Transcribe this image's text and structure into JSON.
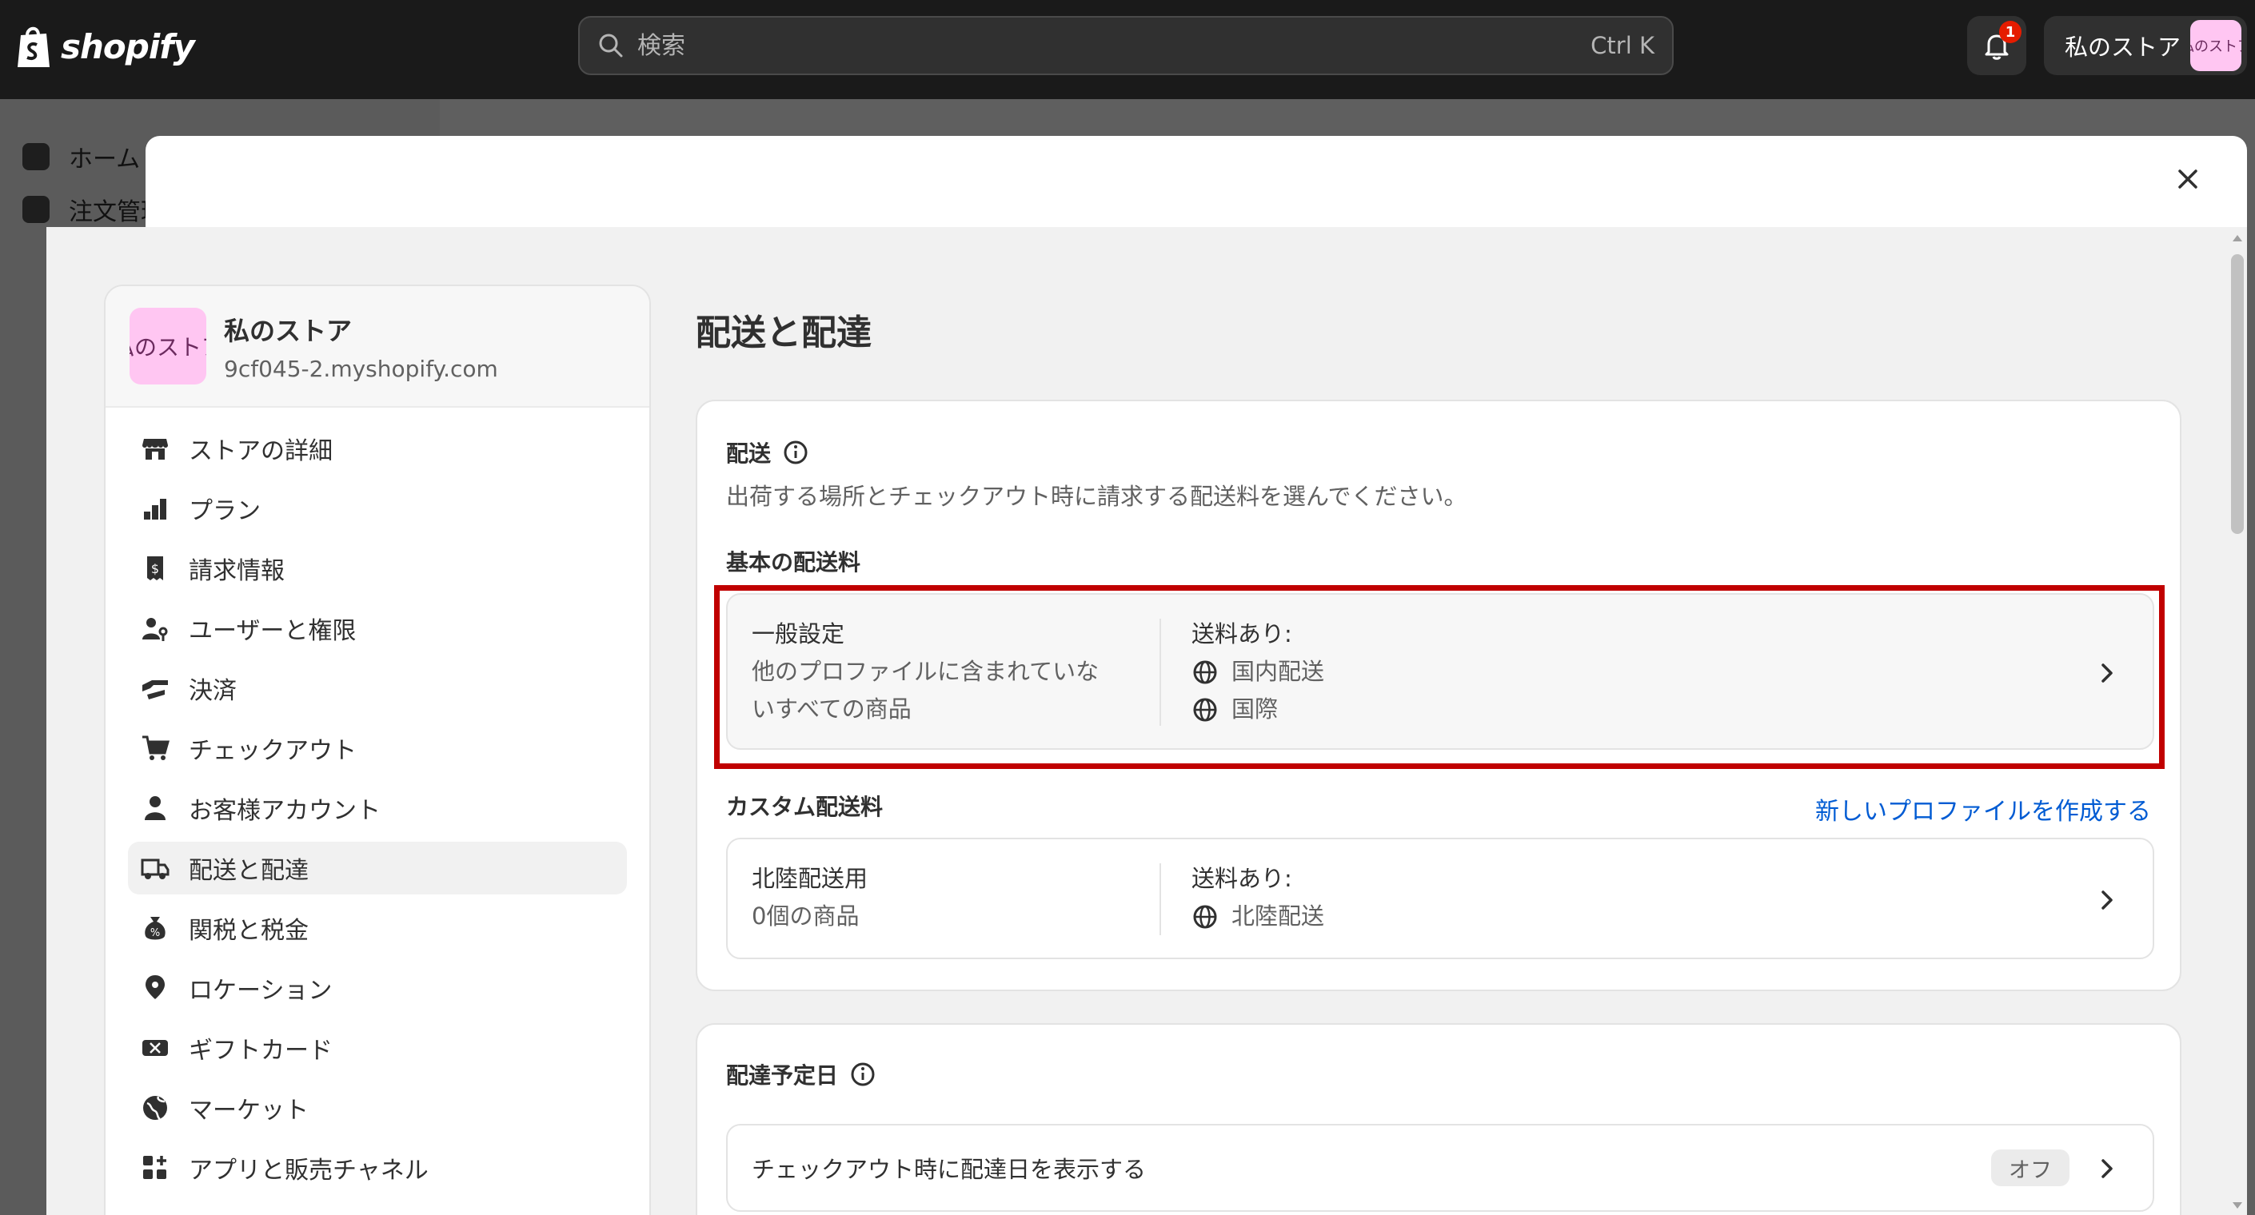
{
  "topbar": {
    "logo_text": "shopify",
    "search_placeholder": "検索",
    "search_shortcut": "Ctrl K",
    "notification_count": "1",
    "store_name": "私のストア",
    "store_avatar_text": "私のストア"
  },
  "background_sidebar": {
    "items": [
      "ホーム",
      "注文管理"
    ]
  },
  "settings_nav": {
    "store_name": "私のストア",
    "store_url": "9cf045-2.myshopify.com",
    "avatar_text": "私のストア",
    "items": [
      {
        "label": "ストアの詳細",
        "icon": "store-icon"
      },
      {
        "label": "プラン",
        "icon": "plan-icon"
      },
      {
        "label": "請求情報",
        "icon": "receipt-icon"
      },
      {
        "label": "ユーザーと権限",
        "icon": "user-key-icon"
      },
      {
        "label": "決済",
        "icon": "payment-icon"
      },
      {
        "label": "チェックアウト",
        "icon": "cart-icon"
      },
      {
        "label": "お客様アカウント",
        "icon": "person-icon"
      },
      {
        "label": "配送と配達",
        "icon": "truck-icon",
        "active": true
      },
      {
        "label": "関税と税金",
        "icon": "tax-icon"
      },
      {
        "label": "ロケーション",
        "icon": "location-icon"
      },
      {
        "label": "ギフトカード",
        "icon": "gift-card-icon"
      },
      {
        "label": "マーケット",
        "icon": "globe-icon"
      },
      {
        "label": "アプリと販売チャネル",
        "icon": "apps-icon"
      }
    ]
  },
  "main": {
    "title": "配送と配達",
    "shipping": {
      "title": "配送",
      "description": "出荷する場所とチェックアウト時に請求する配送料を選んでください。",
      "general_title": "基本の配送料",
      "general_profile": {
        "name": "一般設定",
        "desc_line1": "他のプロファイルに含まれていな",
        "desc_line2": "いすべての商品",
        "rates_label": "送料あり:",
        "zones": [
          "国内配送",
          "国際"
        ]
      },
      "custom_title": "カスタム配送料",
      "create_link": "新しいプロファイルを作成する",
      "custom_profile": {
        "name": "北陸配送用",
        "desc": "0個の商品",
        "rates_label": "送料あり:",
        "zones": [
          "北陸配送"
        ]
      }
    },
    "delivery_date": {
      "title": "配達予定日",
      "row_label": "チェックアウト時に配達日を表示する",
      "status": "オフ"
    }
  },
  "colors": {
    "topbar": "#1a1a1a",
    "highlight": "#c00000",
    "link": "#005bd3",
    "avatar": "#ffc6f2"
  }
}
